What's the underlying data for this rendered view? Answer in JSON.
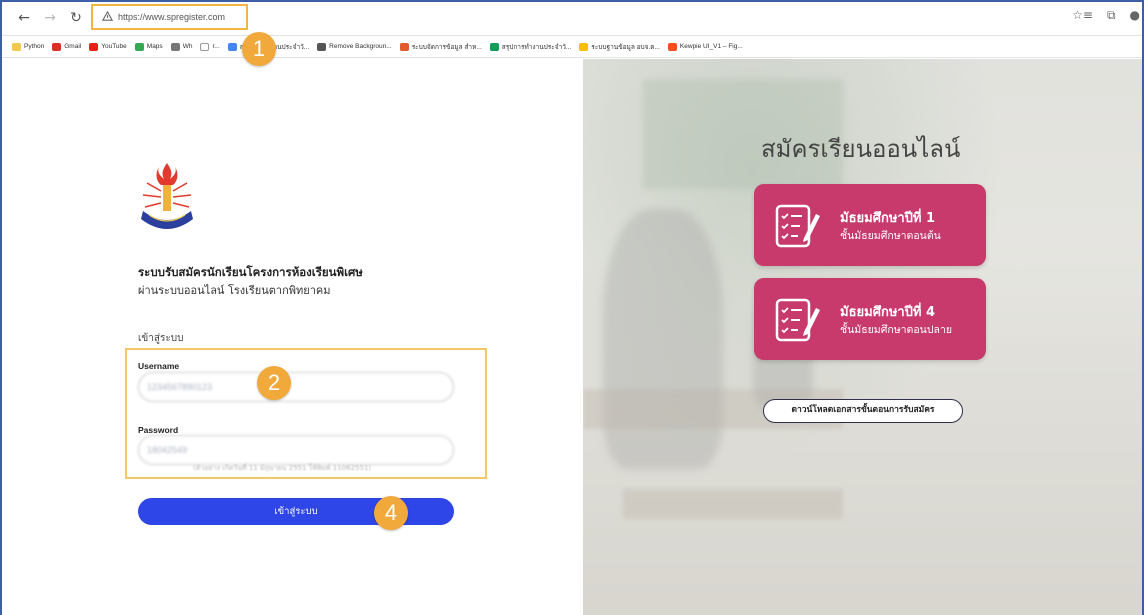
{
  "browser": {
    "url": "https://www.spregister.com",
    "bookmarks": [
      {
        "label": "Python",
        "icon": "folder-icon",
        "color": "#f2c94c"
      },
      {
        "label": "Gmail",
        "icon": "gmail-icon",
        "color": "#d93025"
      },
      {
        "label": "YouTube",
        "icon": "youtube-icon",
        "color": "#e62117"
      },
      {
        "label": "Maps",
        "icon": "maps-icon",
        "color": "#34a853"
      },
      {
        "label": "Wh",
        "icon": "page-icon",
        "color": "#777777"
      },
      {
        "label": "r...",
        "icon": "page-icon",
        "color": "#ffffff"
      },
      {
        "label": "สรุปการทำงานประจำวั...",
        "icon": "google-icon",
        "color": "#4285f4"
      },
      {
        "label": "Remove Backgroun...",
        "icon": "removebg-icon",
        "color": "#555555"
      },
      {
        "label": "ระบบจัดการข้อมูล สำห...",
        "icon": "app-icon",
        "color": "#e05a2b"
      },
      {
        "label": "สรุปการทำงานประจำวั...",
        "icon": "sheets-icon",
        "color": "#0f9d58"
      },
      {
        "label": "ระบบฐานข้อมูล อบจ.ต...",
        "icon": "drive-icon",
        "color": "#fbbc04"
      },
      {
        "label": "Kewpie UI_V1 – Fig...",
        "icon": "figma-icon",
        "color": "#f24e1e"
      }
    ]
  },
  "login": {
    "title": "ระบบรับสมัครนักเรียนโครงการห้องเรียนพิเศษ",
    "subtitle": "ผ่านระบบออนไลน์ โรงเรียนตากพิทยาคม",
    "section_label": "เข้าสู่ระบบ",
    "username_label": "Username",
    "username_value": "1234567890123",
    "password_label": "Password",
    "password_value": "18042549",
    "hint": "(ตัวอย่าง เกิดวันที่ 11 มิถุนายน 2551 ให้พิมพ์ 11062551)",
    "submit_label": "เข้าสู่ระบบ"
  },
  "steps": {
    "step1": "1",
    "step2": "2",
    "step4": "4"
  },
  "register": {
    "heading": "สมัครเรียนออนไลน์",
    "cards": [
      {
        "title": "มัธยมศึกษาปีที่ 1",
        "subtitle": "ชั้นมัธยมศึกษาตอนต้น"
      },
      {
        "title": "มัธยมศึกษาปีที่ 4",
        "subtitle": "ชั้นมัธยมศึกษาตอนปลาย"
      }
    ],
    "download_label": "ดาวน์โหลดเอกสารขั้นตอนการรับสมัคร"
  },
  "colors": {
    "accent": "#2e46e8",
    "card": "#c73a6b",
    "badge": "#f2a93b",
    "highlight": "#f3c767"
  }
}
